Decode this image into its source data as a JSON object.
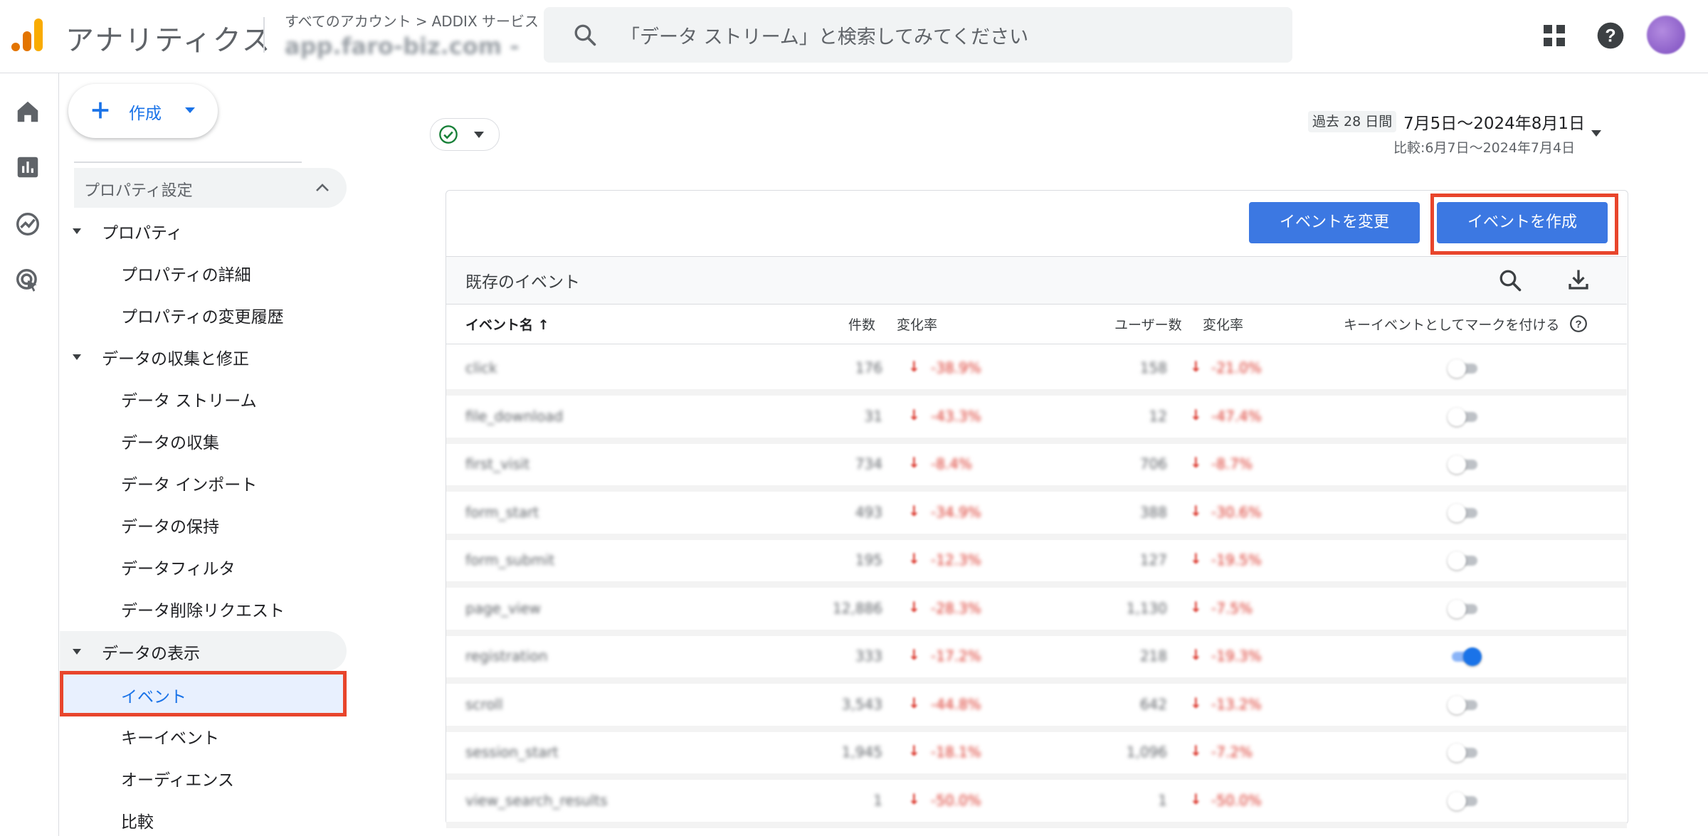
{
  "header": {
    "app_title": "アナリティクス",
    "breadcrumb": [
      "すべてのアカウント",
      "ADDIX サービス"
    ],
    "breadcrumb_separator": ">",
    "property_name": "app.faro-biz.com -",
    "search_placeholder": "「データ ストリーム」と検索してみてください"
  },
  "icons": {
    "logo": "analytics-logo",
    "rail": [
      "home-icon",
      "reports-icon",
      "explore-icon",
      "advertising-icon"
    ],
    "header": [
      "apps-grid-icon",
      "help-icon"
    ]
  },
  "sidebar": {
    "create_label": "作成",
    "settings_label": "プロパティ設定",
    "groups": [
      {
        "label": "プロパティ",
        "items": [
          "プロパティの詳細",
          "プロパティの変更履歴"
        ]
      },
      {
        "label": "データの収集と修正",
        "items": [
          "データ ストリーム",
          "データの収集",
          "データ インポート",
          "データの保持",
          "データフィルタ",
          "データ削除リクエスト"
        ]
      },
      {
        "label": "データの表示",
        "items": [
          "イベント",
          "キーイベント",
          "オーディエンス",
          "比較"
        ]
      }
    ],
    "selected_item": "イベント"
  },
  "date": {
    "badge": "過去 28 日間",
    "range": "7月5日〜2024年8月1日",
    "compare": "比較:6月7日〜2024年7月4日"
  },
  "card": {
    "modify_button": "イベントを変更",
    "create_button": "イベントを作成",
    "existing_label": "既存のイベント"
  },
  "table": {
    "headers": {
      "name": "イベント名",
      "count": "件数",
      "change1": "変化率",
      "users": "ユーザー数",
      "change2": "変化率",
      "key": "キーイベントとしてマークを付ける"
    },
    "rows": [
      {
        "name": "click",
        "count": "176",
        "change1": "-38.9%",
        "users": "158",
        "change2": "-21.0%",
        "key": false
      },
      {
        "name": "file_download",
        "count": "31",
        "change1": "-43.3%",
        "users": "12",
        "change2": "-47.4%",
        "key": false
      },
      {
        "name": "first_visit",
        "count": "734",
        "change1": "-8.4%",
        "users": "706",
        "change2": "-8.7%",
        "key": false
      },
      {
        "name": "form_start",
        "count": "493",
        "change1": "-34.9%",
        "users": "388",
        "change2": "-30.6%",
        "key": false
      },
      {
        "name": "form_submit",
        "count": "195",
        "change1": "-12.3%",
        "users": "127",
        "change2": "-19.5%",
        "key": false
      },
      {
        "name": "page_view",
        "count": "12,886",
        "change1": "-28.3%",
        "users": "1,130",
        "change2": "-7.5%",
        "key": false
      },
      {
        "name": "registration",
        "count": "333",
        "change1": "-17.2%",
        "users": "218",
        "change2": "-19.3%",
        "key": true
      },
      {
        "name": "scroll",
        "count": "3,543",
        "change1": "-44.8%",
        "users": "642",
        "change2": "-13.2%",
        "key": false
      },
      {
        "name": "session_start",
        "count": "1,945",
        "change1": "-18.1%",
        "users": "1,096",
        "change2": "-7.2%",
        "key": false
      },
      {
        "name": "view_search_results",
        "count": "1",
        "change1": "-50.0%",
        "users": "1",
        "change2": "-50.0%",
        "key": false
      }
    ]
  },
  "colors": {
    "accent": "#1a73e8",
    "button": "#3c78e2",
    "highlight": "#e8452c",
    "negative": "#d93025"
  }
}
